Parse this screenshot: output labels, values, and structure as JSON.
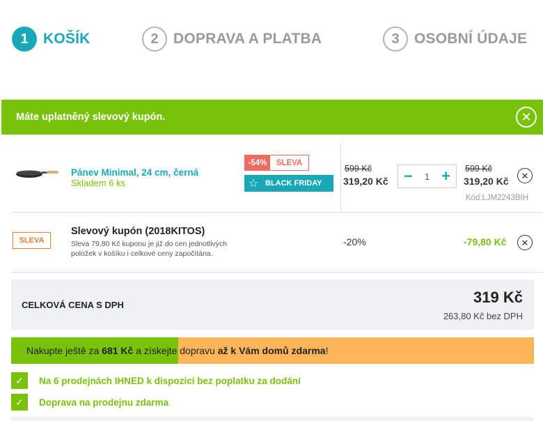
{
  "steps": [
    {
      "num": "1",
      "label": "KOŠÍK"
    },
    {
      "num": "2",
      "label": "DOPRAVA A PLATBA"
    },
    {
      "num": "3",
      "label": "OSOBNÍ ÚDAJE"
    }
  ],
  "banner": {
    "text": "Máte uplatněný slevový kupón.",
    "close": "✕"
  },
  "product": {
    "name": "Pánev Minimal, 24 cm, černá",
    "stock": "Skladem 6 ks",
    "badge_pct": "-54%",
    "badge_label": "SLEVA",
    "badge_bf": "BLACK FRIDAY",
    "unit_old_price": "599 Kč",
    "unit_price": "319,20 Kč",
    "qty": "1",
    "qty_minus": "−",
    "qty_plus": "+",
    "total_old_price": "599 Kč",
    "total_price": "319,20 Kč",
    "code": "Kód:LJM2243BIH"
  },
  "coupon": {
    "badge": "SLEVA",
    "title": "Slevový kupón (2018KITOS)",
    "desc": "Sleva 79,80 Kč kuponu je již do cen jednotlivých položek v košíku i celkové ceny započítána.",
    "pct": "-20%",
    "amount": "-79,80 Kč"
  },
  "total": {
    "label": "CELKOVÁ CENA S DPH",
    "price": "319 Kč",
    "nett": "263,80 Kč bez DPH"
  },
  "shipping": {
    "progress": 0.319,
    "text_1": "Nakupte ještě za ",
    "amount": "681 Kč",
    "text_2": " a získejte dopravu ",
    "text_3": "až k Vám domů zdarma",
    "text_4": "!"
  },
  "benefits": [
    "Na 6 prodejnách IHNED k dispozici bez poplatku za dodání",
    "Doprava na prodejnu zdarma"
  ],
  "colors": {
    "teal": "#17a9b7",
    "green": "#78c20a",
    "orange": "#fdb559",
    "red": "#ef6b62"
  }
}
